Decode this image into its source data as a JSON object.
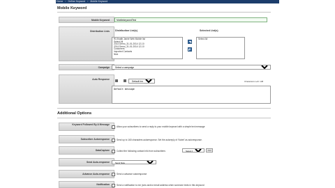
{
  "breadcrumb": [
    "Home",
    "Define Keyword",
    "Mobile Keyword"
  ],
  "main": {
    "title": "Mobile Keyword",
    "fields": {
      "keyword": {
        "label": "Mobile Keyword",
        "value": "MobilekeywordTest"
      },
      "distribution": {
        "label": "Distribution Lists",
        "available_header": "Distribution List(s)",
        "selected_header": "Selected List(s)",
        "available_items": [
          "Rl-Khatib Jamie Web Mobile list",
          "Select All",
          "2014 Demo_31-01-2014 12-10",
          "2014 Demo_31-01-2014 12-10",
          "Customers",
          "Imported Contacts",
          "Nick"
        ],
        "selected_items": [
          "Select All"
        ]
      },
      "campaign": {
        "label": "Campaign",
        "value": "Select a campaign"
      },
      "auto_response": {
        "label": "Auto Response",
        "font": "Default header",
        "counter": "Characters Left: 138",
        "body": "Default message"
      }
    }
  },
  "additional": {
    "title": "Additional Options",
    "rows": [
      {
        "label": "Keyword Followed By A Message",
        "text": "Allow your subscribers to send a reply to your mobile keyword with a simple text message"
      },
      {
        "label": "Subscriber Autoresponse",
        "text": "Send up to 160 characters autoresponse. Set the autoreply of 'Nobel' as autoresponse."
      },
      {
        "label": "DataCapture",
        "text": "Collect the following contact info from subscribers",
        "select": "Select Data Type",
        "button": "Add"
      },
      {
        "label": "Send Auto-response",
        "select": "Send Now"
      },
      {
        "label": "Advance Auto-response",
        "text": "Send a advance autoresponse"
      },
      {
        "label": "Notification",
        "text": "Send a notification to me (sms and/or email address when someone texts in this keyword"
      }
    ]
  }
}
